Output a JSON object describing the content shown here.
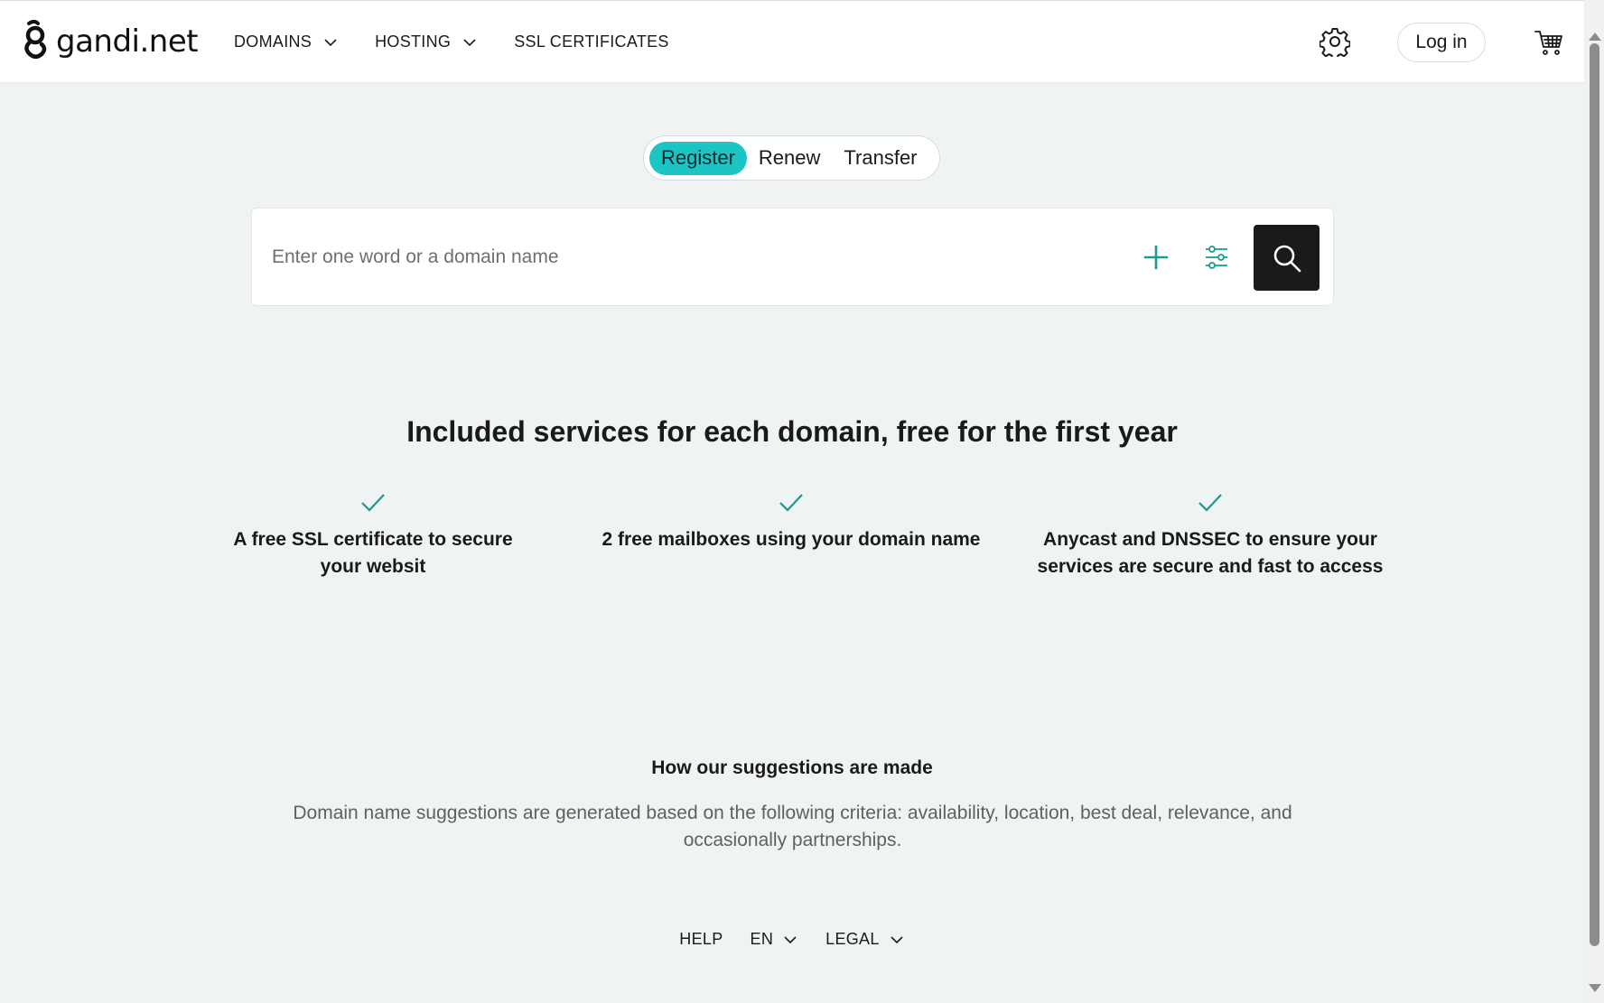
{
  "header": {
    "logo_text": "gandi.net",
    "nav": [
      {
        "label": "DOMAINS"
      },
      {
        "label": "HOSTING"
      },
      {
        "label": "SSL CERTIFICATES"
      }
    ],
    "login_label": "Log in"
  },
  "tabs": [
    {
      "label": "Register",
      "active": true
    },
    {
      "label": "Renew",
      "active": false
    },
    {
      "label": "Transfer",
      "active": false
    }
  ],
  "search": {
    "placeholder": "Enter one word or a domain name",
    "value": ""
  },
  "services": {
    "title": "Included services for each domain, free for the first year",
    "features": [
      {
        "text": "A free SSL certificate to secure your websit"
      },
      {
        "text": "2 free mailboxes using your domain name"
      },
      {
        "text": "Anycast and DNSSEC to ensure your services are secure and fast to access"
      }
    ]
  },
  "suggestions": {
    "title": "How our suggestions are made",
    "text": "Domain name suggestions are generated based on the following criteria: availability, location, best deal, relevance, and occasionally partnerships."
  },
  "footer": {
    "help": "HELP",
    "language": "EN",
    "legal": "LEGAL"
  },
  "colors": {
    "accent": "#1cc4c4",
    "check": "#1a9a8f",
    "background": "#f0f3f3",
    "search_button": "#1a1a1a"
  },
  "icons": [
    "gandi-logo-icon",
    "chevron-down-icon",
    "gear-icon",
    "cart-icon",
    "plus-icon",
    "filter-icon",
    "search-icon",
    "check-icon"
  ]
}
